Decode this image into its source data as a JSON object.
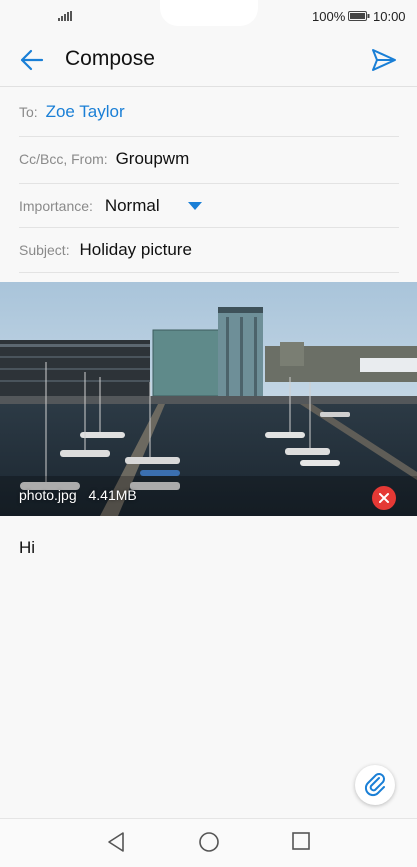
{
  "status_bar": {
    "battery_percent": "100%",
    "time": "10:00",
    "signal_icon": "signal-icon",
    "battery_icon": "battery-icon"
  },
  "app_bar": {
    "title": "Compose",
    "back_icon": "arrow-left-icon",
    "send_icon": "send-icon"
  },
  "fields": {
    "to_label": "To:",
    "to_value": "Zoe Taylor",
    "cc_label": "Cc/Bcc, From:",
    "cc_value": "Groupwm",
    "importance_label": "Importance:",
    "importance_value": "Normal",
    "subject_label": "Subject:",
    "subject_value": "Holiday picture"
  },
  "attachment": {
    "file_name": "photo.jpg",
    "file_size": "4.41MB",
    "remove_icon": "close-icon"
  },
  "message_body": "Hi",
  "attach_button_icon": "paperclip-icon",
  "navigation": [
    "back-triangle-icon",
    "home-circle-icon",
    "recents-square-icon"
  ],
  "colors": {
    "accent": "#1a7fd6",
    "remove_red": "#e53935"
  }
}
